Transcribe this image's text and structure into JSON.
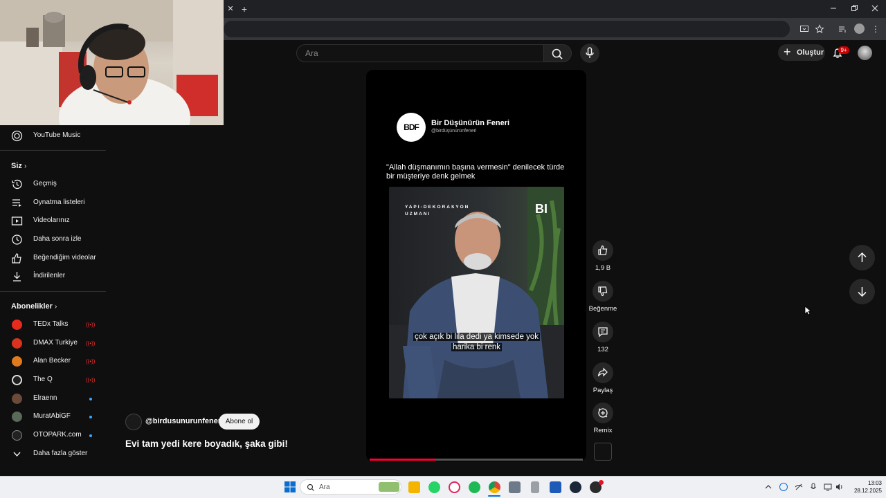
{
  "search": {
    "placeholder": "Ara"
  },
  "header": {
    "create_label": "Oluştur",
    "notifications_badge": "9+"
  },
  "sidebar": {
    "music": "YouTube Music",
    "you_heading": "Siz",
    "you_items": [
      "Geçmiş",
      "Oynatma listeleri",
      "Videolarınız",
      "Daha sonra izle",
      "Beğendiğim videolar",
      "İndirilenler"
    ],
    "subs_heading": "Abonelikler",
    "subscriptions": [
      {
        "name": "TEDx Talks",
        "status": "live"
      },
      {
        "name": "DMAX Turkiye",
        "status": "live"
      },
      {
        "name": "Alan Becker",
        "status": "live"
      },
      {
        "name": "The Q",
        "status": "live"
      },
      {
        "name": "Elraenn",
        "status": "new"
      },
      {
        "name": "MuratAbiGF",
        "status": "new"
      },
      {
        "name": "OTOPARK.com",
        "status": "new"
      }
    ],
    "show_more": "Daha fazla göster"
  },
  "video": {
    "overlay_channel_logo": "BDF",
    "overlay_channel_name": "Bir Düşünürün Feneri",
    "overlay_channel_handle": "@birdüşünürünfeneri",
    "overlay_caption": "\"Allah düşmanımın başına vermesin\" denilecek türde bir müşteriye denk gelmek",
    "inner_tag": "YAPI-DEKORASYON UZMANI",
    "inner_logo": "BI",
    "subtitle_line1": "çok açık bi lila dedi ya kimsede yok",
    "subtitle_line2": "harika bi renk",
    "progress": 0.31,
    "channel_handle": "@birdusunurunfeneri",
    "subscribe_label": "Abone ol",
    "title": "Evi tam yedi kere boyadık, şaka gibi!"
  },
  "actions": {
    "like_count": "1,9 B",
    "dislike_label": "Beğenme",
    "comment_count": "132",
    "share_label": "Paylaş",
    "remix_label": "Remix"
  },
  "taskbar": {
    "search_placeholder": "Ara",
    "time": "13:03",
    "date": "28.12.2025"
  },
  "colors": {
    "accent_red": "#ff0033",
    "background": "#0f0f0f"
  }
}
